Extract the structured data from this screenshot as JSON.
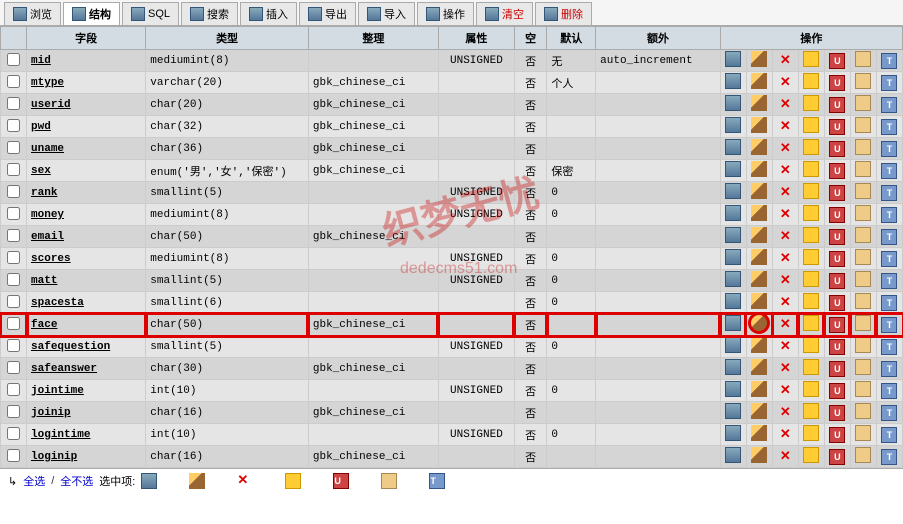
{
  "tabs": [
    {
      "label": "浏览",
      "active": false
    },
    {
      "label": "结构",
      "active": true
    },
    {
      "label": "SQL",
      "active": false
    },
    {
      "label": "搜索",
      "active": false
    },
    {
      "label": "插入",
      "active": false
    },
    {
      "label": "导出",
      "active": false
    },
    {
      "label": "导入",
      "active": false
    },
    {
      "label": "操作",
      "active": false
    },
    {
      "label": "清空",
      "active": false,
      "danger": true
    },
    {
      "label": "删除",
      "active": false,
      "danger": true
    }
  ],
  "headers": {
    "field": "字段",
    "type": "类型",
    "collation": "整理",
    "attributes": "属性",
    "null": "空",
    "default": "默认",
    "extra": "额外",
    "action": "操作"
  },
  "rows": [
    {
      "field": "mid",
      "type": "mediumint(8)",
      "coll": "",
      "attr": "UNSIGNED",
      "null": "否",
      "def": "无",
      "extra": "auto_increment",
      "hl": false
    },
    {
      "field": "mtype",
      "type": "varchar(20)",
      "coll": "gbk_chinese_ci",
      "attr": "",
      "null": "否",
      "def": "个人",
      "extra": "",
      "hl": false
    },
    {
      "field": "userid",
      "type": "char(20)",
      "coll": "gbk_chinese_ci",
      "attr": "",
      "null": "否",
      "def": "",
      "extra": "",
      "hl": false
    },
    {
      "field": "pwd",
      "type": "char(32)",
      "coll": "gbk_chinese_ci",
      "attr": "",
      "null": "否",
      "def": "",
      "extra": "",
      "hl": false
    },
    {
      "field": "uname",
      "type": "char(36)",
      "coll": "gbk_chinese_ci",
      "attr": "",
      "null": "否",
      "def": "",
      "extra": "",
      "hl": false
    },
    {
      "field": "sex",
      "type": "enum('男','女','保密')",
      "coll": "gbk_chinese_ci",
      "attr": "",
      "null": "否",
      "def": "保密",
      "extra": "",
      "hl": false
    },
    {
      "field": "rank",
      "type": "smallint(5)",
      "coll": "",
      "attr": "UNSIGNED",
      "null": "否",
      "def": "0",
      "extra": "",
      "hl": false
    },
    {
      "field": "money",
      "type": "mediumint(8)",
      "coll": "",
      "attr": "UNSIGNED",
      "null": "否",
      "def": "0",
      "extra": "",
      "hl": false
    },
    {
      "field": "email",
      "type": "char(50)",
      "coll": "gbk_chinese_ci",
      "attr": "",
      "null": "否",
      "def": "",
      "extra": "",
      "hl": false
    },
    {
      "field": "scores",
      "type": "mediumint(8)",
      "coll": "",
      "attr": "UNSIGNED",
      "null": "否",
      "def": "0",
      "extra": "",
      "hl": false
    },
    {
      "field": "matt",
      "type": "smallint(5)",
      "coll": "",
      "attr": "UNSIGNED",
      "null": "否",
      "def": "0",
      "extra": "",
      "hl": false
    },
    {
      "field": "spacesta",
      "type": "smallint(6)",
      "coll": "",
      "attr": "",
      "null": "否",
      "def": "0",
      "extra": "",
      "hl": false
    },
    {
      "field": "face",
      "type": "char(50)",
      "coll": "gbk_chinese_ci",
      "attr": "",
      "null": "否",
      "def": "",
      "extra": "",
      "hl": true
    },
    {
      "field": "safequestion",
      "type": "smallint(5)",
      "coll": "",
      "attr": "UNSIGNED",
      "null": "否",
      "def": "0",
      "extra": "",
      "hl": false
    },
    {
      "field": "safeanswer",
      "type": "char(30)",
      "coll": "gbk_chinese_ci",
      "attr": "",
      "null": "否",
      "def": "",
      "extra": "",
      "hl": false
    },
    {
      "field": "jointime",
      "type": "int(10)",
      "coll": "",
      "attr": "UNSIGNED",
      "null": "否",
      "def": "0",
      "extra": "",
      "hl": false
    },
    {
      "field": "joinip",
      "type": "char(16)",
      "coll": "gbk_chinese_ci",
      "attr": "",
      "null": "否",
      "def": "",
      "extra": "",
      "hl": false
    },
    {
      "field": "logintime",
      "type": "int(10)",
      "coll": "",
      "attr": "UNSIGNED",
      "null": "否",
      "def": "0",
      "extra": "",
      "hl": false
    },
    {
      "field": "loginip",
      "type": "char(16)",
      "coll": "gbk_chinese_ci",
      "attr": "",
      "null": "否",
      "def": "",
      "extra": "",
      "hl": false
    }
  ],
  "footer": {
    "select_all": "全选",
    "unselect_all": "全不选",
    "selected_label": "选中项:"
  },
  "watermark": "织梦无忧",
  "watermark_url": "dedecms51.com"
}
